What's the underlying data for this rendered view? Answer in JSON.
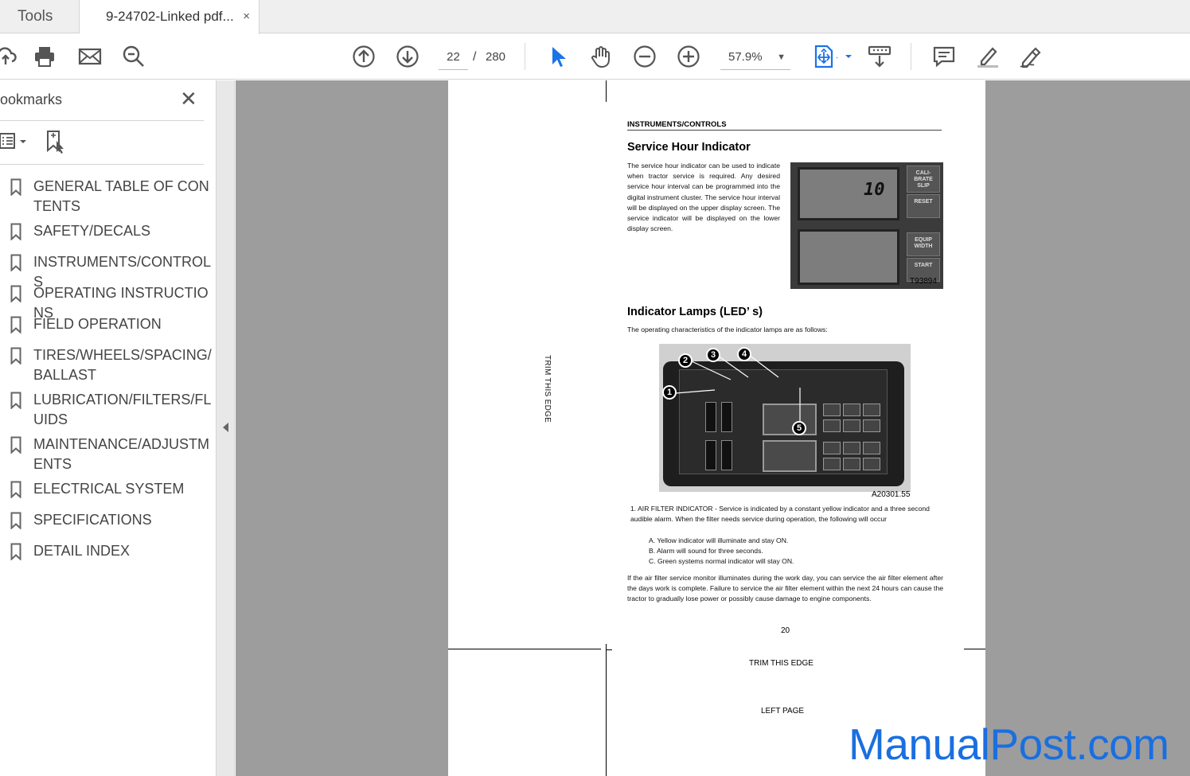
{
  "tabs": {
    "tools_label": "Tools",
    "document_label": "9-24702-Linked pdf...",
    "close_glyph": "×"
  },
  "toolbar": {
    "current_page": "22",
    "page_separator": "/",
    "total_pages": "280",
    "zoom": "57.9%"
  },
  "sidebar": {
    "title": "ookmarks",
    "close_glyph": "✕",
    "bookmarks": [
      {
        "label": "GENERAL TABLE OF CONTENTS"
      },
      {
        "label": "SAFETY/DECALS"
      },
      {
        "label": "INSTRUMENTS/CONTROLS"
      },
      {
        "label": "OPERATING INSTRUCTIONS"
      },
      {
        "label": "FIELD OPERATION"
      },
      {
        "label": "TIRES/WHEELS/SPACING/BALLAST"
      },
      {
        "label": "LUBRICATION/FILTERS/FLUIDS"
      },
      {
        "label": "MAINTENANCE/ADJUSTMENTS"
      },
      {
        "label": "ELECTRICAL SYSTEM"
      },
      {
        "label": "SPECIFICATIONS"
      },
      {
        "label": "DETAIL INDEX"
      }
    ]
  },
  "page": {
    "trim_vertical": "TRIM THIS EDGE",
    "section_header": "INSTRUMENTS/CONTROLS",
    "heading1": "Service Hour Indicator",
    "para1": "The service hour indicator can be used to indicate when tractor service is required. Any desired service hour interval can be programmed into the digital instrument cluster. The service hour interval will be displayed on the upper display screen. The service indicator will be displayed on the lower display screen.",
    "photo1": {
      "lcd_value": "10",
      "btn_calibrate": "CALI-BRATE SLIP",
      "btn_reset": "RESET",
      "btn_equip": "EQUIP WIDTH",
      "btn_start": "START",
      "caption": "T93894"
    },
    "heading2": "Indicator Lamps (LED’ s)",
    "para2": "The operating characteristics of the indicator lamps are as follows:",
    "photo2": {
      "caption": "A20301.55",
      "callouts": [
        "1",
        "2",
        "3",
        "4",
        "5"
      ]
    },
    "item1": "1.  AIR FILTER INDICATOR - Service is indicated by a constant yellow indicator and a three second audible alarm. When the filter needs service during operation, the following will occur",
    "sub_a": "A.  Yellow indicator will illuminate and stay ON.",
    "sub_b": "B.  Alarm will sound for three seconds.",
    "sub_c": "C.  Green systems normal indicator will stay ON.",
    "para3": "If the air filter service monitor illuminates during the work day, you can service the air filter element after the days work is complete. Failure to service the air filter element within the next 24 hours can cause the tractor to gradually lose power or possibly cause damage to engine components.",
    "page_number": "20",
    "trim_bottom": "TRIM THIS EDGE",
    "left_page": "LEFT PAGE"
  },
  "watermark": "ManualPost.com",
  "colors": {
    "accent_blue": "#1a73e8",
    "doc_background": "#9d9d9d",
    "watermark": "#1a6fe0"
  },
  "icons": [
    "cloud-upload-icon",
    "print-icon",
    "mail-icon",
    "zoom-search-icon",
    "page-up-icon",
    "page-down-icon",
    "select-cursor-icon",
    "hand-icon",
    "zoom-out-icon",
    "zoom-in-icon",
    "fit-page-icon",
    "scroll-mode-icon",
    "comment-icon",
    "highlight-pen-icon",
    "sign-icon",
    "bookmark-icon"
  ]
}
